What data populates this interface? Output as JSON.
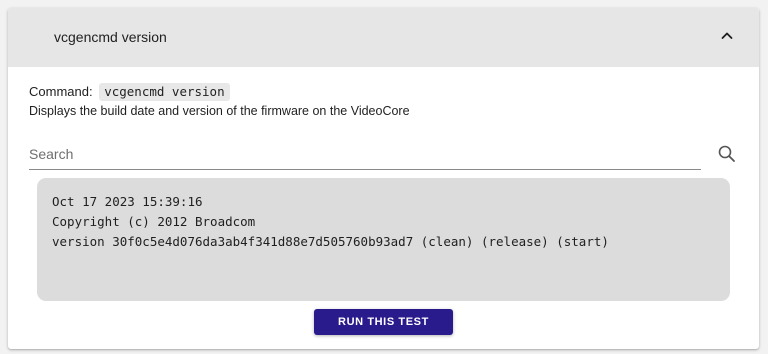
{
  "panel": {
    "title": "vcgencmd version",
    "collapse_icon": "chevron-up-icon"
  },
  "command": {
    "label": "Command:",
    "value": "vcgencmd version"
  },
  "description": "Displays the build date and version of the firmware on the VideoCore",
  "search": {
    "placeholder": "Search",
    "value": "",
    "icon": "search-icon"
  },
  "output": {
    "lines": [
      "Oct 17 2023 15:39:16",
      "Copyright (c) 2012 Broadcom",
      "version 30f0c5e4d076da3ab4f341d88e7d505760b93ad7 (clean) (release) (start)"
    ]
  },
  "run_button": {
    "label": "RUN THIS TEST"
  },
  "colors": {
    "header_bg": "#e6e6e6",
    "output_bg": "#dcdcdc",
    "button_bg": "#2a1b8d",
    "page_bg": "#f2f2f2"
  }
}
